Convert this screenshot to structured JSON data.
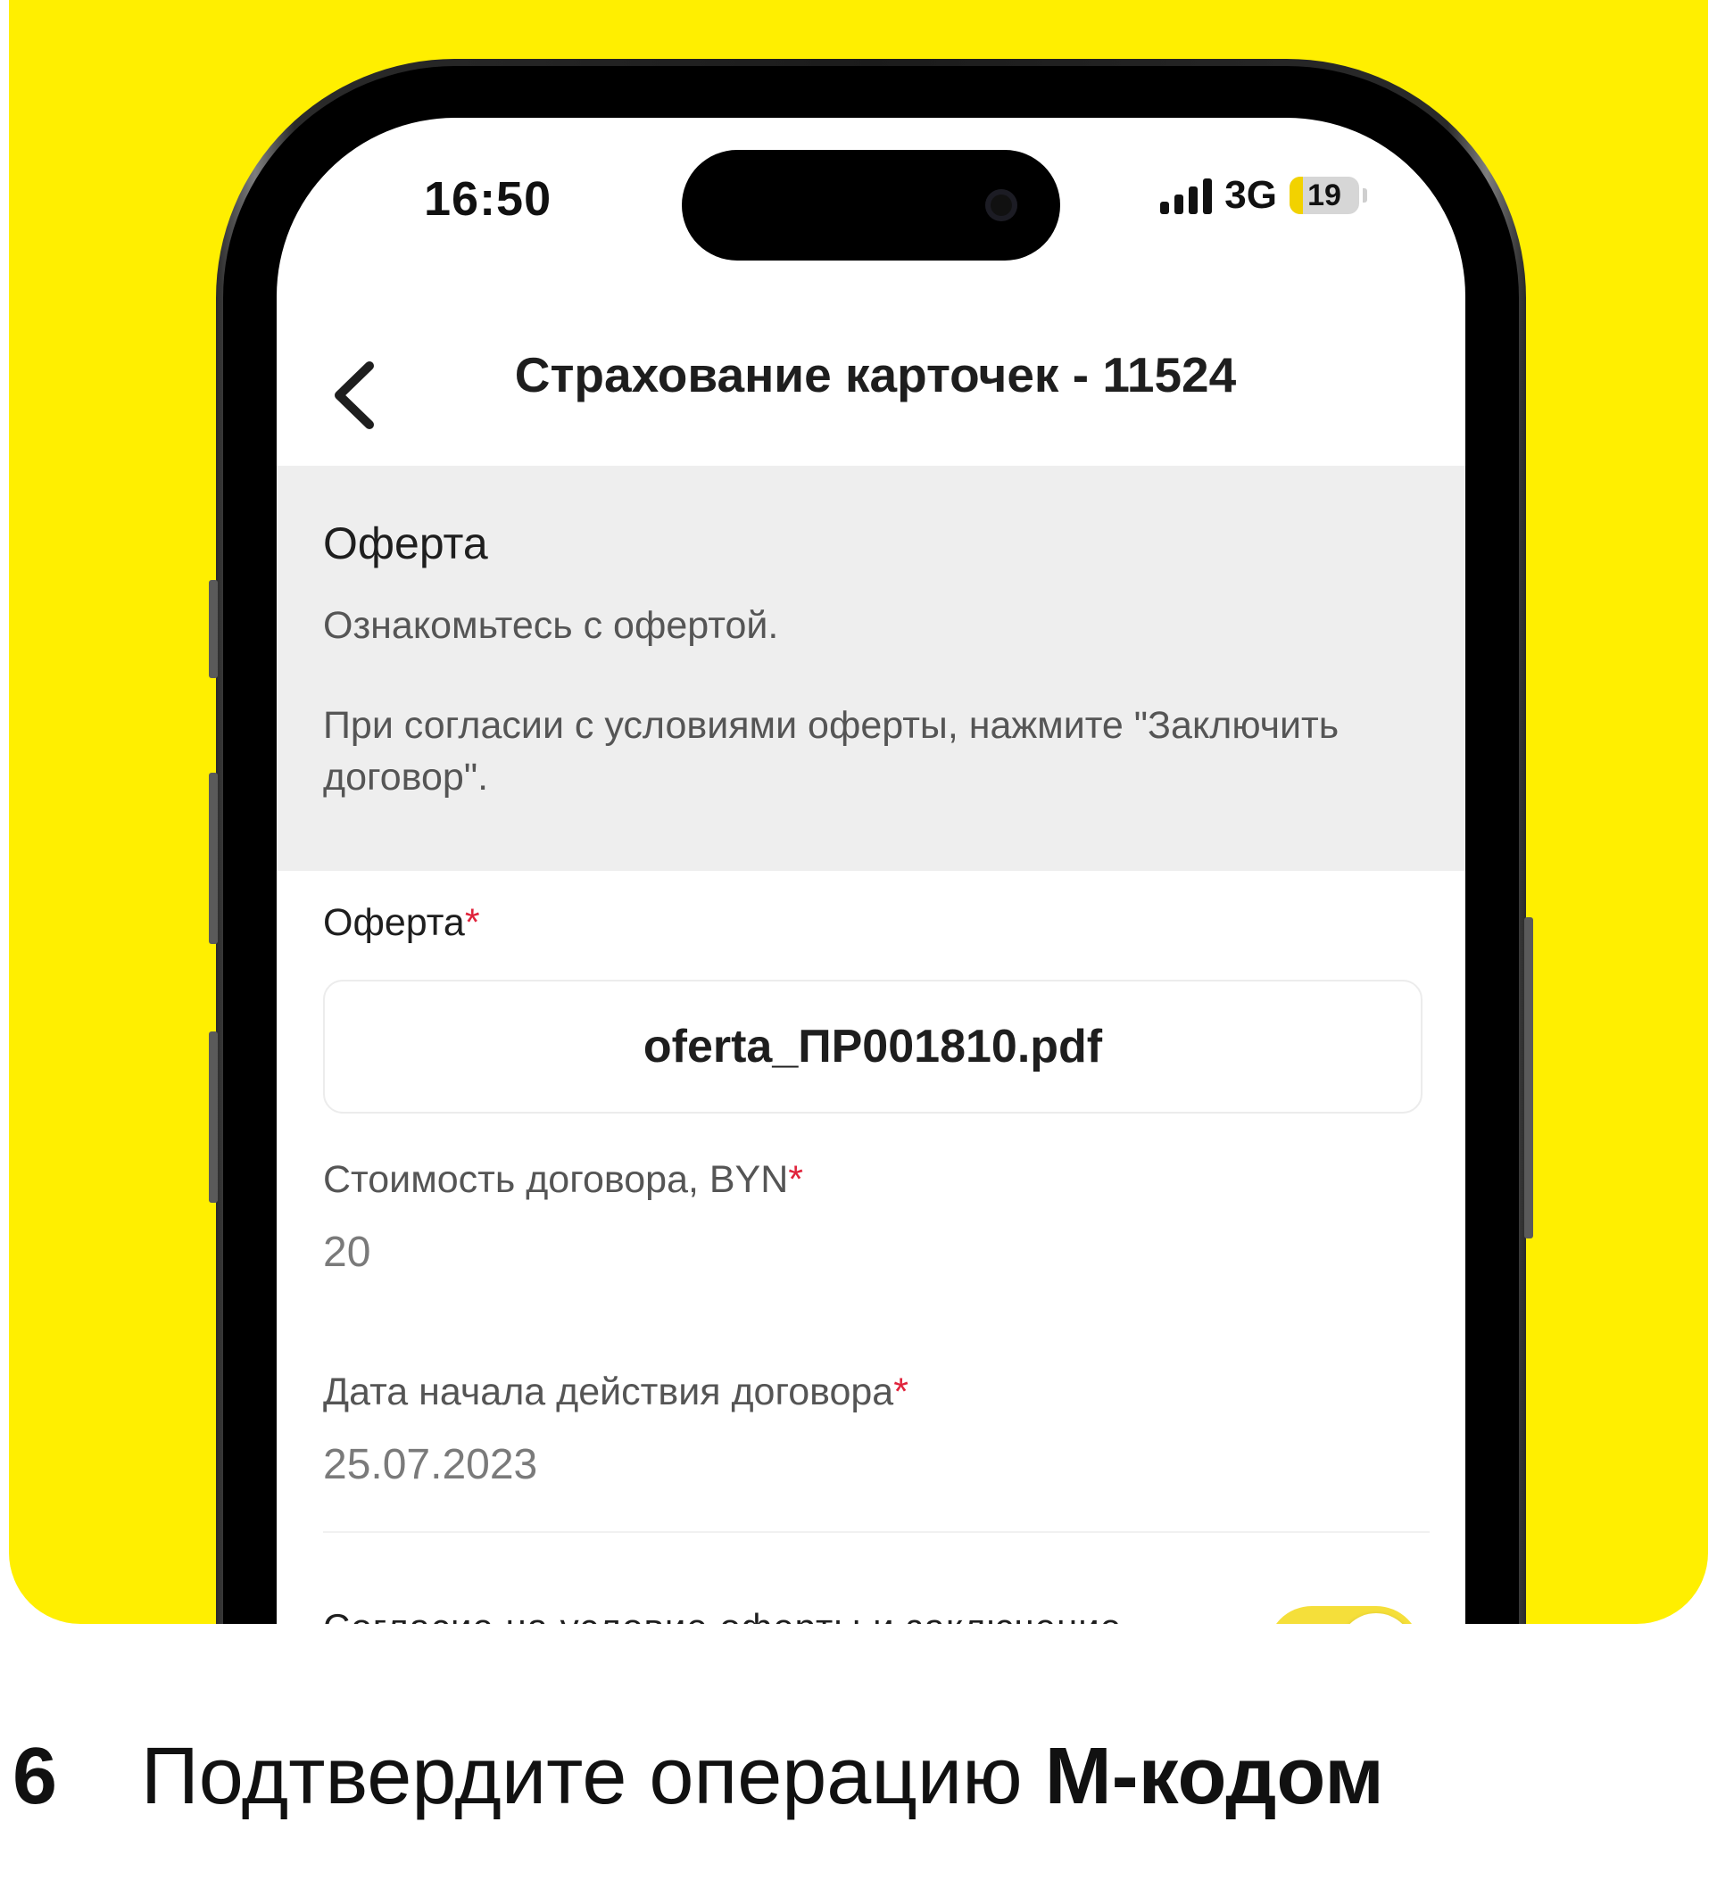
{
  "status_bar": {
    "time": "16:50",
    "network": "3G",
    "battery_level": "19",
    "battery_fraction": 0.19,
    "signal_icon": "cellular-signal-icon"
  },
  "header": {
    "back_icon": "chevron-left-icon",
    "title": "Страхование карточек - 11524"
  },
  "info": {
    "title": "Оферта",
    "line1": "Ознакомьтесь с офертой.",
    "line2": "При согласии с условиями оферты, нажмите \"Заключить договор\"."
  },
  "form": {
    "offer_label": "Оферта",
    "offer_file": "oferta_ПР001810.pdf",
    "cost_label": "Стоимость договора, BYN",
    "cost_value": "20",
    "start_date_label": "Дата начала действия договора",
    "start_date_value": "25.07.2023",
    "consent_label": "Согласие на условие оферты и заключение договора страхования",
    "consent_on": true,
    "required_mark": "*"
  },
  "colors": {
    "brand_yellow": "#FFEF00",
    "required_red": "#E0233B",
    "toggle_yellow": "#F5DF3A"
  },
  "footer": {
    "step_number": "6",
    "step_text": "Подтвердите операцию",
    "step_text_bold": "М-кодом"
  }
}
